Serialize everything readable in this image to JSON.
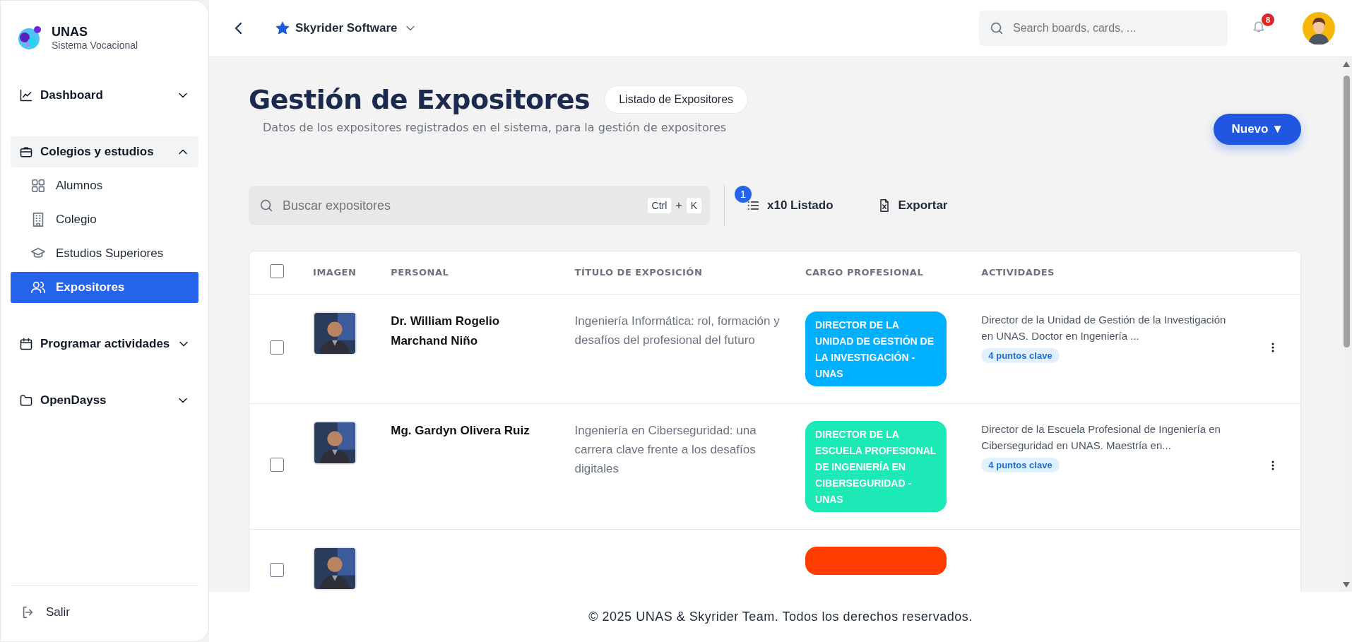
{
  "brand": {
    "title": "UNAS",
    "subtitle": "Sistema Vocacional"
  },
  "sidebar": {
    "items": [
      {
        "label": "Dashboard",
        "expanded": false
      },
      {
        "label": "Colegios y estudios",
        "expanded": true,
        "children": [
          {
            "label": "Alumnos",
            "selected": false
          },
          {
            "label": "Colegio",
            "selected": false
          },
          {
            "label": "Estudios Superiores",
            "selected": false
          },
          {
            "label": "Expositores",
            "selected": true
          }
        ]
      },
      {
        "label": "Programar actividades",
        "expanded": false
      },
      {
        "label": "OpenDayss",
        "expanded": false
      }
    ],
    "logout": "Salir"
  },
  "header": {
    "workspace": "Skyrider Software",
    "search": {
      "placeholder": "Search boards, cards, ..."
    },
    "notifications": "8"
  },
  "page": {
    "title": "Gestión de Expositores",
    "tag": "Listado de Expositores",
    "subtitle": "Datos de los expositores registrados en el sistema, para la gestión de expositores",
    "new_button": "Nuevo ▼"
  },
  "toolbar": {
    "search": {
      "placeholder": "Buscar expositores"
    },
    "keys": [
      "Ctrl",
      "+",
      "K"
    ],
    "count_badge": "1",
    "list_button": "x10 Listado",
    "export_button": "Exportar"
  },
  "table": {
    "columns": [
      "IMAGEN",
      "PERSONAL",
      "TÍTULO DE EXPOSICIÓN",
      "CARGO PROFESIONAL",
      "ACTIVIDADES"
    ],
    "all_checked": false,
    "rows": [
      {
        "checked": false,
        "name": "Dr. William Rogelio Marchand Niño",
        "title": "Ingeniería Informática: rol, formación y desafíos del profesional del futuro",
        "cargo": "DIRECTOR DE LA UNIDAD DE GESTIÓN DE LA INVESTIGACIÓN - UNAS",
        "color": "#00b0ff",
        "activity": "Director de la Unidad de Gestión de la Investigación en UNAS. Doctor en Ingeniería ...",
        "points": "4 puntos clave"
      },
      {
        "checked": false,
        "name": "Mg. Gardyn Olivera Ruiz",
        "title": "Ingeniería en Ciberseguridad: una carrera clave frente a los desafíos digitales",
        "cargo": "DIRECTOR DE LA ESCUELA PROFESIONAL DE INGENIERÍA EN CIBERSEGURIDAD - UNAS",
        "color": "#1de9b6",
        "activity": "Director de la Escuela Profesional de Ingeniería en Ciberseguridad en UNAS. Maestría en...",
        "points": "4 puntos clave"
      },
      {
        "checked": false,
        "color": "#ff3d00"
      }
    ]
  },
  "footer": "© 2025 UNAS & Skyrider Team. Todos los derechos reservados."
}
